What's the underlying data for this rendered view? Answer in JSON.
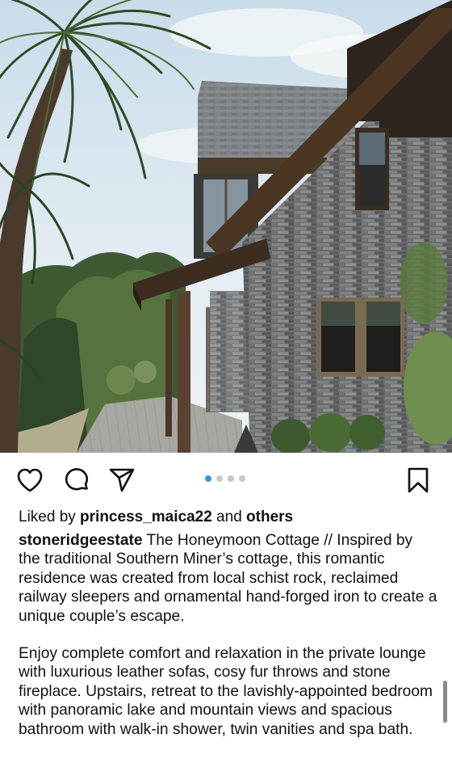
{
  "post": {
    "photo_alt": "Stone cottage",
    "carousel": {
      "count": 4,
      "active_index": 0
    },
    "actions": {
      "like_icon": "heart-icon",
      "comment_icon": "comment-icon",
      "share_icon": "send-icon",
      "save_icon": "bookmark-icon"
    },
    "likes": {
      "prefix": "Liked by ",
      "user": "princess_maica22",
      "middle": " and ",
      "others": "others"
    },
    "caption": {
      "username": "stoneridgeestate",
      "paragraph1": " The Honeymoon Cottage // Inspired by the traditional Southern Miner’s cottage, this romantic residence was created from local schist rock, reclaimed railway sleepers and ornamental hand-forged iron to create a unique couple’s escape.",
      "paragraph2": "Enjoy complete comfort and relaxation in the private lounge with luxurious leather sofas, cosy fur throws and stone fireplace. Upstairs, retreat to the lavishly-appointed bedroom with panoramic lake and mountain views and spacious bathroom with walk-in shower, twin vanities and spa bath."
    },
    "colors": {
      "carousel_active": "#2f95f1",
      "carousel_inactive": "#c7c7c7",
      "icon": "#111111"
    }
  }
}
